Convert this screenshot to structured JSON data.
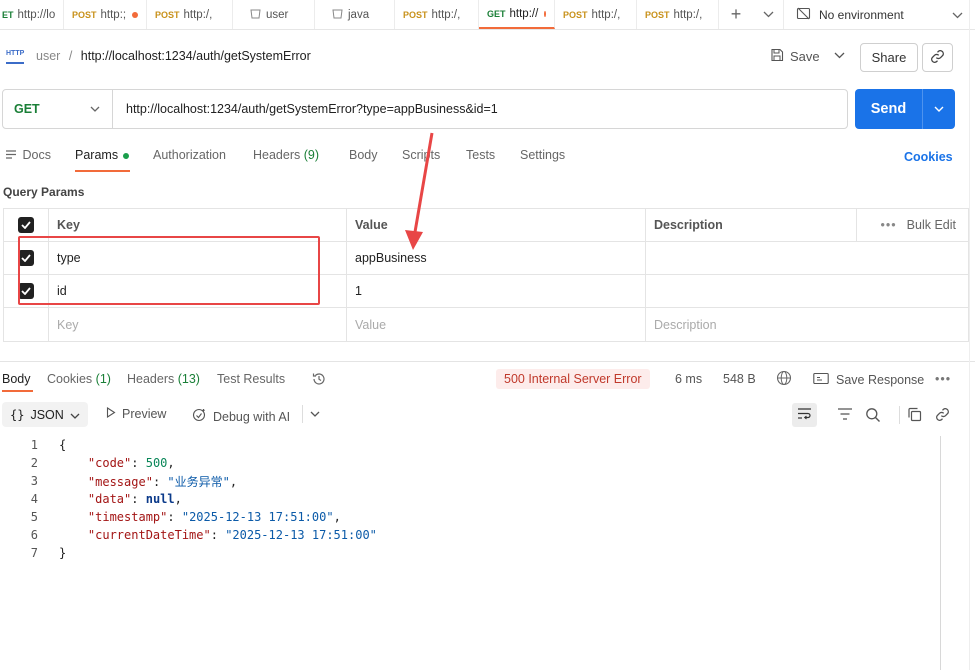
{
  "tabs": [
    {
      "method": "ET",
      "label": "http://lo",
      "dot": false
    },
    {
      "method": "POST",
      "label": "http:;",
      "dot": true
    },
    {
      "method": "POST",
      "label": "http:/,",
      "dot": false
    },
    {
      "method": "",
      "label": "user",
      "dot": false,
      "icon": "collection-icon"
    },
    {
      "method": "",
      "label": "java",
      "dot": false,
      "icon": "collection-icon"
    },
    {
      "method": "POST",
      "label": "http:/,",
      "dot": false
    },
    {
      "method": "GET",
      "label": "http://",
      "dot": true,
      "active": true
    },
    {
      "method": "POST",
      "label": "http:/,",
      "dot": false
    },
    {
      "method": "POST",
      "label": "http:/,",
      "dot": false
    }
  ],
  "environment": {
    "label": "No environment"
  },
  "breadcrumb": {
    "parent": "user",
    "separator": "/",
    "current": "http://localhost:1234/auth/getSystemError"
  },
  "toolbar": {
    "save_label": "Save",
    "share_label": "Share"
  },
  "request": {
    "method": "GET",
    "url": "http://localhost:1234/auth/getSystemError?type=appBusiness&id=1",
    "send_label": "Send"
  },
  "request_tabs": {
    "docs": "Docs",
    "params": "Params",
    "authorization": "Authorization",
    "headers": "Headers",
    "headers_count": "(9)",
    "body": "Body",
    "scripts": "Scripts",
    "tests": "Tests",
    "settings": "Settings",
    "cookies": "Cookies"
  },
  "query_params": {
    "title": "Query Params",
    "headers": {
      "key": "Key",
      "value": "Value",
      "description": "Description",
      "bulk_edit": "Bulk Edit"
    },
    "rows": [
      {
        "key": "type",
        "value": "appBusiness",
        "checked": true
      },
      {
        "key": "id",
        "value": "1",
        "checked": true
      }
    ],
    "placeholder": {
      "key": "Key",
      "value": "Value",
      "description": "Description"
    }
  },
  "response_tabs": {
    "body": "Body",
    "cookies": "Cookies",
    "cookies_count": "(1)",
    "headers": "Headers",
    "headers_count": "(13)",
    "test_results": "Test Results"
  },
  "response_meta": {
    "status": "500 Internal Server Error",
    "time": "6 ms",
    "size": "548 B",
    "save_response": "Save Response"
  },
  "body_toolbar": {
    "format": "JSON",
    "preview": "Preview",
    "debug": "Debug with AI"
  },
  "response_body": {
    "code_key": "\"code\"",
    "code_val": "500",
    "message_key": "\"message\"",
    "message_val": "\"业务异常\"",
    "data_key": "\"data\"",
    "data_val": "null",
    "timestamp_key": "\"timestamp\"",
    "timestamp_val": "\"2025-12-13 17:51:00\"",
    "cdt_key": "\"currentDateTime\"",
    "cdt_val": "\"2025-12-13 17:51:00\"",
    "line_numbers": [
      "1",
      "2",
      "3",
      "4",
      "5",
      "6",
      "7"
    ]
  },
  "colors": {
    "accent": "#f26b3a",
    "send": "#1a73e8",
    "get": "#1a7f37",
    "post": "#c8911a",
    "error_bg": "#fdeceb",
    "annotation": "#e84646"
  }
}
